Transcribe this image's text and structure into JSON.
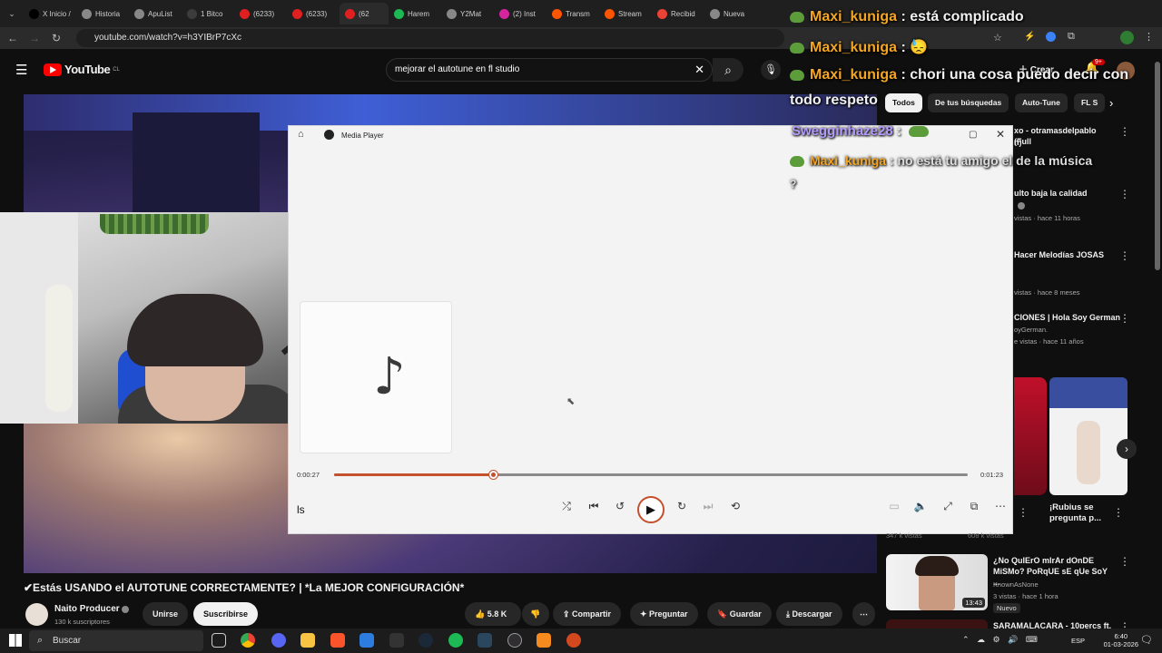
{
  "browser": {
    "tabs": [
      {
        "label": "X  Inicio /",
        "color": "#000000"
      },
      {
        "label": "Historia",
        "color": "#888888"
      },
      {
        "label": "ApuList",
        "color": "#888888"
      },
      {
        "label": "1 Bitco",
        "color": "#3c3c3c"
      },
      {
        "label": "(6233)",
        "color": "#e02020"
      },
      {
        "label": "(6233)",
        "color": "#e02020"
      },
      {
        "label": "(62",
        "color": "#e02020"
      },
      {
        "label": "Harem",
        "color": "#1db954"
      },
      {
        "label": "Y2Mat",
        "color": "#888888"
      },
      {
        "label": "(2) Inst",
        "color": "#d6249f"
      },
      {
        "label": "Transm",
        "color": "#ff5500"
      },
      {
        "label": "Stream",
        "color": "#ff5500"
      },
      {
        "label": "Recibid",
        "color": "#ea4335"
      },
      {
        "label": "Nueva",
        "color": "#888888"
      }
    ],
    "url": "youtube.com/watch?v=h3YIBrP7cXc"
  },
  "youtube": {
    "logo": "YouTube",
    "logo_region": "CL",
    "search_value": "mejorar el autotune en fl studio",
    "create_label": "Crear",
    "notif_count": "9+",
    "chips": [
      "Todos",
      "De tus búsquedas",
      "Auto-Tune",
      "FL S"
    ],
    "video_title": "✔Estás USANDO el AUTOTUNE CORRECTAMENTE? | *La MEJOR CONFIGURACIÓN*",
    "channel": "Naito Producer",
    "subscribers": "130 k suscriptores",
    "join_label": "Unirse",
    "subscribe_label": "Suscribirse",
    "likes": "5.8 K",
    "share_label": "Compartir",
    "ask_label": "Preguntar",
    "save_label": "Guardar",
    "download_label": "Descargar"
  },
  "recommendations": [
    {
      "title": "xo - otramasdelpablo (Full",
      "sub": "n)"
    },
    {
      "title": "ulto baja la calidad",
      "sub": "vistas · hace 11 horas"
    },
    {
      "title": "Hacer Melodías JOSAS",
      "sub": "vistas · hace 8 meses"
    },
    {
      "title": "CIONES | Hola Soy German",
      "sub": "oyGerman.",
      "sub2": "e vistas · hace 11 años"
    },
    {
      "title": "¡Rubius se pregunta p...",
      "sub": "347 k vistas",
      "sub_left": "608 k vistas"
    },
    {
      "title": "¿No QuIErO mIrAr dOnDE MiSMo? PoRqUE sE qUe SoY ...",
      "sub": "KnownAsNone",
      "sub2": "3 vistas · hace 1 hora",
      "badge": "Nuevo",
      "duration": "13:43"
    },
    {
      "title": "SARAMALACARA - 10percs ft.",
      "sub": ""
    }
  ],
  "media_player": {
    "title": "Media Player",
    "current_time": "0:00:27",
    "total_time": "0:01:23",
    "progress": 0.25,
    "song": "ls"
  },
  "chat": [
    {
      "user": "Maxi_kuniga",
      "text": ": está complicado"
    },
    {
      "user": "Maxi_kuniga",
      "text": ": 😓"
    },
    {
      "user": "Maxi_kuniga",
      "text": ": chori una cosa puedo decir con"
    },
    {
      "user": "",
      "text": "todo respeto"
    },
    {
      "user": "Swegginhaze28",
      "text": ":"
    },
    {
      "user": "Maxi_kuniga",
      "text": ": no está tu amigo el de la música"
    },
    {
      "user": "",
      "text": "?"
    }
  ],
  "taskbar": {
    "search_placeholder": "Buscar",
    "lang": "ESP",
    "time": "6:40",
    "date": "01-03-2026"
  }
}
